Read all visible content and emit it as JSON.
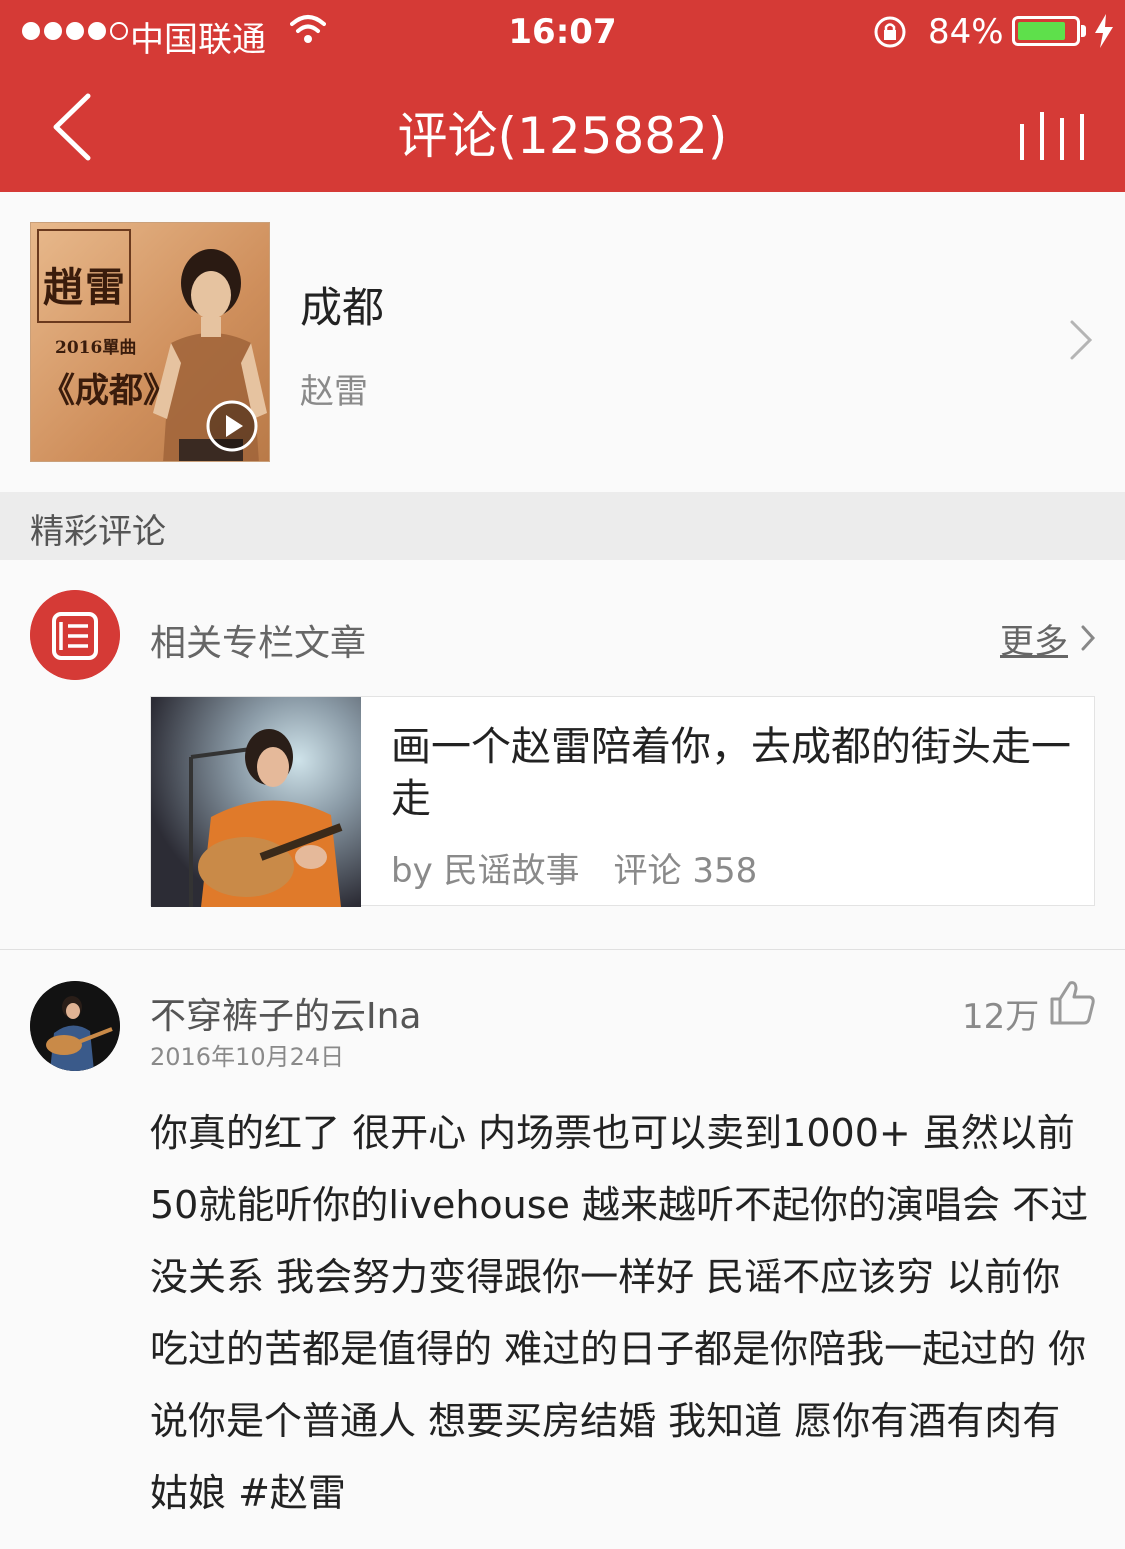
{
  "status_bar": {
    "carrier": "中国联通",
    "time": "16:07",
    "battery_percent": "84%",
    "battery_level": 0.84
  },
  "nav": {
    "title": "评论(125882)"
  },
  "song": {
    "title": "成都",
    "artist": "赵雷",
    "cover": {
      "name": "趙雷",
      "year": "2016單曲",
      "title": "《成都》"
    }
  },
  "section": {
    "title": "精彩评论"
  },
  "related": {
    "label": "相关专栏文章",
    "more": "更多",
    "article": {
      "title": "画一个赵雷陪着你，去成都的街头走一走",
      "author": "by 民谣故事",
      "comments": "评论 358"
    }
  },
  "comment": {
    "user": "不穿裤子的云Ina",
    "date": "2016年10月24日",
    "likes": "12万",
    "text": "你真的红了 很开心 内场票也可以卖到1000+ 虽然以前50就能听你的livehouse 越来越听不起你的演唱会 不过没关系 我会努力变得跟你一样好 民谣不应该穷 以前你吃过的苦都是值得的 难过的日子都是你陪我一起过的 你说你是个普通人 想要买房结婚 我知道 愿你有酒有肉有姑娘 #赵雷"
  },
  "colors": {
    "brand": "#d53a36",
    "battery": "#5ee04b"
  }
}
